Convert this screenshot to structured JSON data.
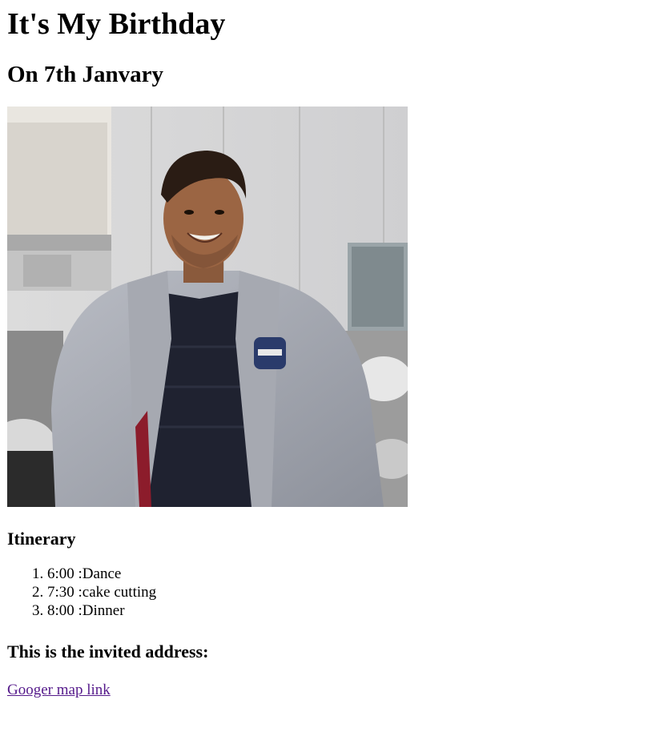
{
  "page": {
    "title": "It's My Birthday",
    "date_heading": "On 7th Janvary",
    "itinerary_heading": "Itinerary",
    "itinerary": [
      "6:00 :Dance",
      "7:30 :cake cutting",
      "8:00 :Dinner"
    ],
    "address_heading": "This is the invited address:",
    "map_link_text": "Googer map link"
  },
  "colors": {
    "visited_link": "#551a8b"
  }
}
